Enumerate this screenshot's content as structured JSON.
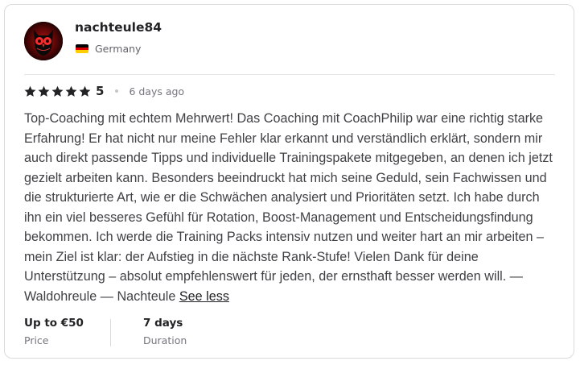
{
  "reviewer": {
    "username": "nachteule84",
    "country": "Germany",
    "flag_colors": [
      "#000000",
      "#dd0000",
      "#ffce00"
    ]
  },
  "review": {
    "rating": 5,
    "rating_label": "5",
    "time_ago": "6 days ago",
    "text": "Top-Coaching mit echtem Mehrwert! Das Coaching mit CoachPhilip war eine richtig starke Erfahrung! Er hat nicht nur meine Fehler klar erkannt und verständlich erklärt, sondern mir auch direkt passende Tipps und individuelle Trainingspakete mitgegeben, an denen ich jetzt gezielt arbeiten kann. Besonders beeindruckt hat mich seine Geduld, sein Fachwissen und die strukturierte Art, wie er die Schwächen analysiert und Prioritäten setzt. Ich habe durch ihn ein viel besseres Gefühl für Rotation, Boost-Management und Entscheidungsfindung bekommen. Ich werde die Training Packs intensiv nutzen und weiter hart an mir arbeiten – mein Ziel ist klar: der Aufstieg in die nächste Rank-Stufe! Vielen Dank für deine Unterstützung – absolut empfehlenswert für jeden, der ernsthaft besser werden will. — Waldohreule — Nachteule",
    "see_less_label": "See less"
  },
  "details": {
    "price_value": "Up to €50",
    "price_label": "Price",
    "duration_value": "7 days",
    "duration_label": "Duration"
  },
  "colors": {
    "star": "#222325",
    "text": "#404145",
    "muted": "#74767e"
  },
  "icons": {
    "avatar": "owl-avatar",
    "star": "star-icon",
    "flag": "germany-flag-icon"
  }
}
